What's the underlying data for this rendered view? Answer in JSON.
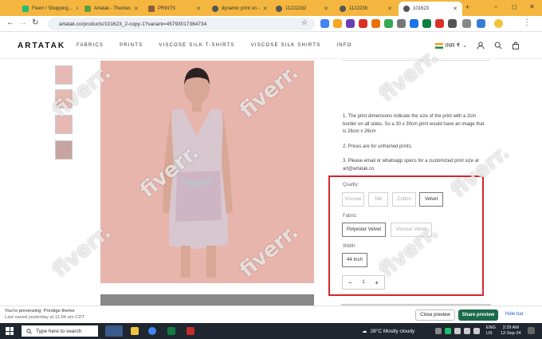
{
  "browser": {
    "tabs": [
      {
        "label": "Fiverr / Shopping...",
        "color": "#1dbf73"
      },
      {
        "label": "Artatak - Themes",
        "color": "#5b9e3b"
      },
      {
        "label": "PRINTS",
        "color": "#8e5b3a"
      },
      {
        "label": "dynamic print on -",
        "color": "#555"
      },
      {
        "label": "11222282",
        "color": "#555"
      },
      {
        "label": "1122238",
        "color": "#555"
      },
      {
        "label": "101623",
        "color": "#555"
      }
    ],
    "url": "artatak.co/products/101623_2-copy-1?variant=45793017364734",
    "window_controls": {
      "minimize": "–",
      "maximize": "◻",
      "close": "✕"
    },
    "new_tab": "+"
  },
  "site": {
    "logo": "ARTATAK",
    "nav": [
      "FABRICS",
      "PRINTS",
      "VISCOSE SILK T-SHIRTS",
      "VISCOSE SILK SHIRTS",
      "INFO"
    ],
    "currency": "INR ₹",
    "icons": [
      "user-icon",
      "search-icon",
      "bag-icon"
    ]
  },
  "product": {
    "notes": [
      "1. The print dimensions indicate the size of the print with a 2cm border on all sides. So a 30 x 30cm print would have an image that is 26cm x 26cm",
      "2. Prices are for unframed prints.",
      "3. Please email or whatsapp specs for a customized print size at art@artatak.co"
    ],
    "quality_label": "Quality:",
    "quality_options": [
      "Viscose",
      "Silk",
      "Cotton",
      "Velvet"
    ],
    "quality_selected": "Velvet",
    "fabric_label": "Fabric:",
    "fabric_options": [
      "Polyester Velvet",
      "Viscose Velvet"
    ],
    "fabric_selected": "Polyester Velvet",
    "width_label": "Width:",
    "width_options": [
      "44 Inch"
    ],
    "width_selected": "44 Inch",
    "quantity": "1",
    "minus": "−",
    "plus": "+",
    "highlight_color": "#d6262b"
  },
  "preview_bar": {
    "line1": "You're previewing: Prestige theme",
    "line2": "Last saved yesterday at 11:04 am CDT",
    "close_label": "Close preview",
    "share_label": "Share preview",
    "hide_label": "Hide bar"
  },
  "taskbar": {
    "search_placeholder": "Type here to search",
    "weather": "28°C  Mostly cloudy",
    "lang": "ENG",
    "region": "US",
    "time": "2:29 AM",
    "date": "12-Sep-24"
  },
  "watermark": "fiverr."
}
